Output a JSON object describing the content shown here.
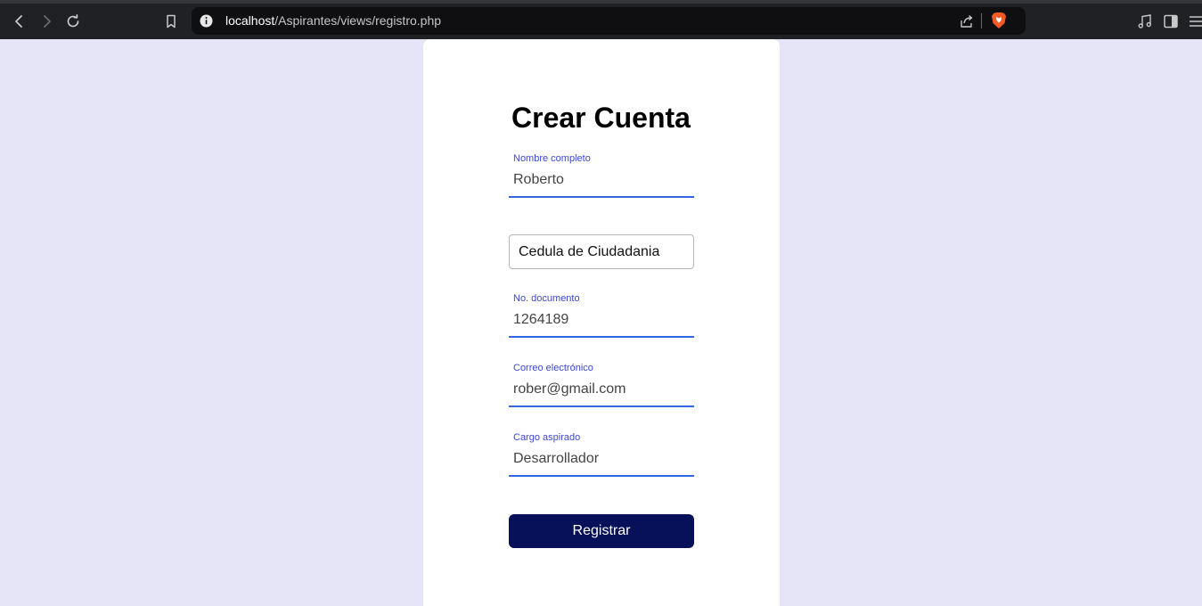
{
  "browser": {
    "url_host": "localhost",
    "url_path": "/Aspirantes/views/registro.php",
    "icons": {
      "back": "arrow-left-icon",
      "forward": "arrow-right-icon",
      "reload": "reload-icon",
      "bookmark": "bookmark-icon",
      "site_info": "info-icon",
      "share": "share-icon",
      "brave": "brave-shield-icon",
      "media": "music-note-icon",
      "sidebar": "sidebar-icon",
      "menu": "hamburger-menu-icon"
    }
  },
  "form": {
    "title": "Crear Cuenta",
    "fields": [
      {
        "label": "Nombre completo",
        "value": "Roberto"
      },
      {
        "label": "No. documento",
        "value": "1264189"
      },
      {
        "label": "Correo electrónico",
        "value": "rober@gmail.com"
      },
      {
        "label": "Cargo aspirado",
        "value": "Desarrollador"
      }
    ],
    "document_type": {
      "selected": "Cedula de Ciudadania"
    },
    "submit_label": "Registrar"
  },
  "colors": {
    "page_background": "#e6e4f7",
    "card_background": "#ffffff",
    "field_label": "#3d46d6",
    "field_underline": "#3366e0",
    "button_background": "#071159",
    "button_text": "#ffffff",
    "browser_chrome": "#202124",
    "omnibox": "#0f0f12"
  }
}
